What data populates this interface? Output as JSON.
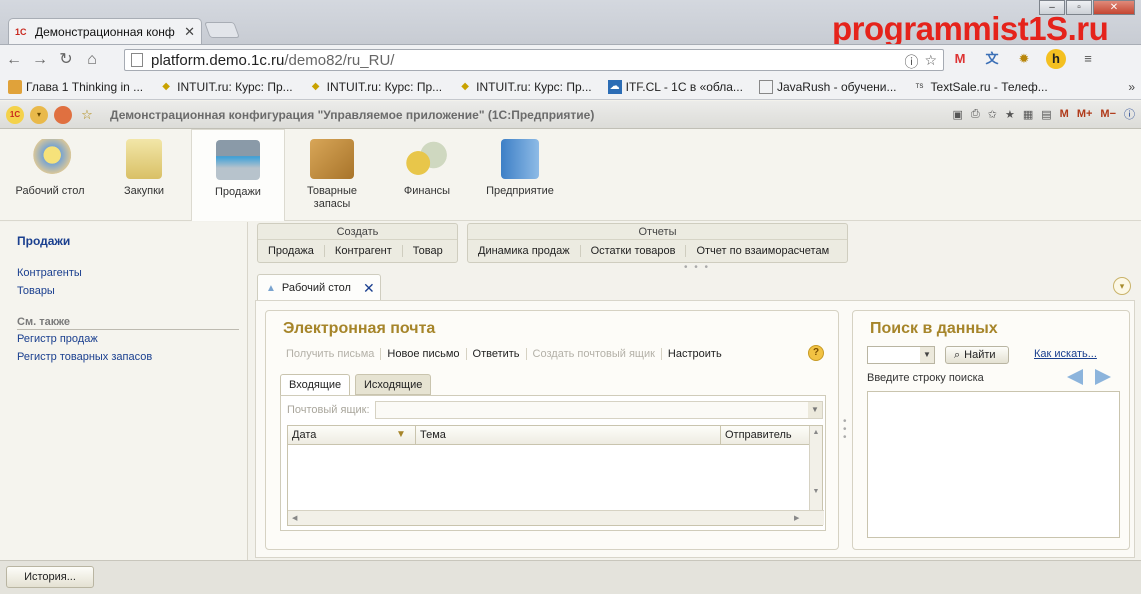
{
  "browser": {
    "tab_title": "Демонстрационная конф",
    "tab_favicon": "1С",
    "tab_close": "✕",
    "brand_text": "programmist1S.ru",
    "address": {
      "host": "platform.demo.1c.ru",
      "path": "/demo82/ru_RU/"
    },
    "bookmarks": [
      {
        "icon": "folder-icon",
        "label": "Глава 1 Thinking in ..."
      },
      {
        "icon": "intuit-icon",
        "label": "INTUIT.ru: Курс: Пр..."
      },
      {
        "icon": "intuit-icon",
        "label": "INTUIT.ru: Курс: Пр..."
      },
      {
        "icon": "intuit-icon",
        "label": "INTUIT.ru: Курс: Пр..."
      },
      {
        "icon": "cloud-icon",
        "label": "ITF.CL - 1С в «обла..."
      },
      {
        "icon": "page-icon",
        "label": "JavaRush - обучени..."
      },
      {
        "icon": "textsale-icon",
        "label": "TextSale.ru - Телеф..."
      }
    ],
    "bookmarks_more": "»"
  },
  "app": {
    "title": "Демонстрационная конфигурация \"Управляемое приложение\" (1С:Предприятие)",
    "memory_buttons": [
      "M",
      "M+",
      "M−"
    ],
    "sections": [
      {
        "label": "Рабочий стол",
        "icon": "desk-lamp-icon"
      },
      {
        "label": "Закупки",
        "icon": "shopping-bag-icon"
      },
      {
        "label": "Продажи",
        "icon": "cash-register-icon",
        "active": true
      },
      {
        "label": "Товарные запасы",
        "icon": "box-icon"
      },
      {
        "label": "Финансы",
        "icon": "coins-icon"
      },
      {
        "label": "Предприятие",
        "icon": "building-icon"
      }
    ],
    "nav": {
      "title": "Продажи",
      "links": [
        "Контрагенты",
        "Товары"
      ],
      "see_also": "См. также",
      "see_also_links": [
        "Регистр продаж",
        "Регистр товарных запасов"
      ]
    },
    "create_group": {
      "title": "Создать",
      "items": [
        "Продажа",
        "Контрагент",
        "Товар"
      ]
    },
    "reports_group": {
      "title": "Отчеты",
      "items": [
        "Динамика продаж",
        "Остатки товаров",
        "Отчет по взаиморасчетам"
      ]
    },
    "work_tab": "Рабочий стол",
    "email": {
      "title": "Электронная почта",
      "commands": [
        {
          "label": "Получить письма",
          "disabled": true
        },
        {
          "label": "Новое письмо",
          "disabled": false
        },
        {
          "label": "Ответить",
          "disabled": false
        },
        {
          "label": "Создать почтовый ящик",
          "disabled": true
        },
        {
          "label": "Настроить",
          "disabled": false
        }
      ],
      "tabs": [
        "Входящие",
        "Исходящие"
      ],
      "mailbox_label": "Почтовый ящик:",
      "columns": [
        "Дата",
        "Тема",
        "Отправитель"
      ]
    },
    "search": {
      "title": "Поиск в данных",
      "find_button": "Найти",
      "how_link": "Как искать...",
      "hint": "Введите строку поиска"
    },
    "history_button": "История..."
  }
}
